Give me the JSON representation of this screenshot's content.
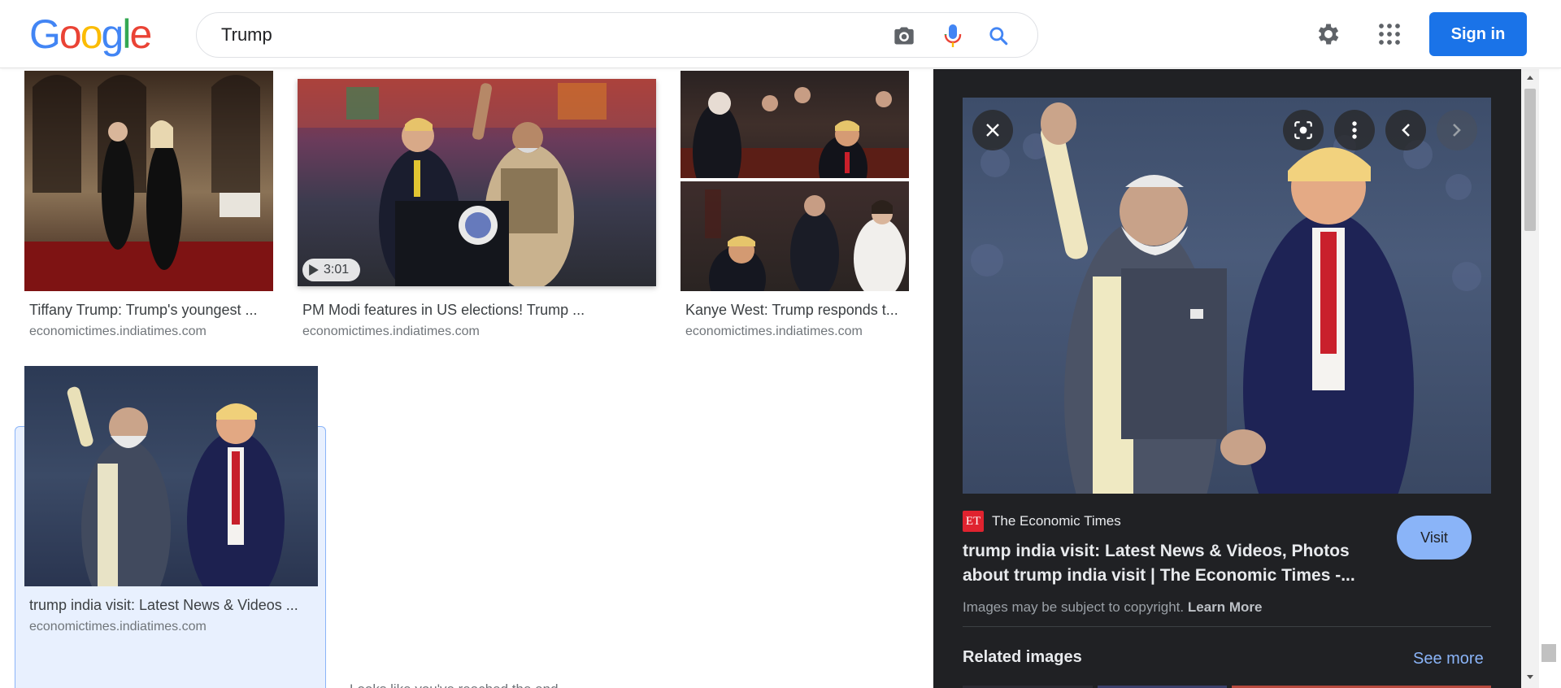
{
  "header": {
    "logo": [
      "G",
      "o",
      "o",
      "g",
      "l",
      "e"
    ],
    "logo_colors": [
      "#4285F4",
      "#EA4335",
      "#FBBC05",
      "#4285F4",
      "#34A853",
      "#EA4335"
    ],
    "search_value": "Trump",
    "icons": [
      "camera-icon",
      "mic-icon",
      "search-icon",
      "gear-icon",
      "apps-grid-icon"
    ],
    "sign_in_label": "Sign in"
  },
  "results": [
    {
      "title": "Tiffany Trump: Trump's youngest ...",
      "site": "economictimes.indiatimes.com"
    },
    {
      "title": "PM Modi features in US elections! Trump ...",
      "site": "economictimes.indiatimes.com",
      "duration": "3:01"
    },
    {
      "title": "Kanye West: Trump responds t...",
      "site": "economictimes.indiatimes.com"
    },
    {
      "title": "trump india visit: Latest News & Videos ...",
      "site": "economictimes.indiatimes.com",
      "selected": true
    }
  ],
  "partial_text": "Looks like you've reached the end",
  "panel": {
    "source_logo": "ET",
    "source_name": "The Economic Times",
    "title": "trump india visit: Latest News & Videos, Photos about trump india visit | The Economic Times -...",
    "visit_label": "Visit",
    "copyright": "Images may be subject to copyright.",
    "learn_more": "Learn More",
    "related_label": "Related images",
    "see_more_label": "See more",
    "controls": [
      "close-icon",
      "lens-icon",
      "more-options-icon",
      "chevron-left-icon",
      "chevron-right-icon"
    ]
  },
  "colors": {
    "accent": "#1a73e8",
    "panel_bg": "#202124",
    "link_light": "#8ab4f8",
    "et_red": "#e0232f"
  }
}
